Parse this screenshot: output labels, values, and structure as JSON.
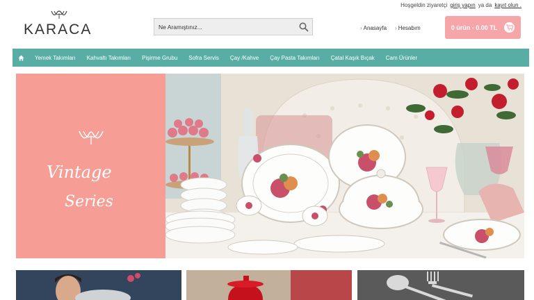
{
  "topbar": {
    "greeting": "Hoşgeldin ziyaretçi",
    "login_link": "giriş yapın",
    "or_text": "ya da",
    "register_link": "kayıt olun ."
  },
  "logo": {
    "text": "KARACA"
  },
  "search": {
    "placeholder": "Ne Aramıştınız..."
  },
  "header_links": {
    "home": "Anasayfa",
    "account": "Hesabım"
  },
  "cart": {
    "summary": "0 ürün - 0.00 TL"
  },
  "nav": {
    "items": [
      {
        "label": "Yemek Takımları"
      },
      {
        "label": "Kahvaltı Takımları"
      },
      {
        "label": "Pişirme Grubu"
      },
      {
        "label": "Sofra Servis"
      },
      {
        "label": "Çay /Kahve"
      },
      {
        "label": "Çay Pasta Takımları"
      },
      {
        "label": "Çatal Kaşık Bıçak"
      },
      {
        "label": "Cam Ürünler"
      }
    ]
  },
  "hero": {
    "script_line_1": "Vintage",
    "script_line_2": "Series"
  },
  "colors": {
    "accent": "#58aea4",
    "brand_pink": "#f6a5a8",
    "hero_pink": "#f69e95"
  }
}
